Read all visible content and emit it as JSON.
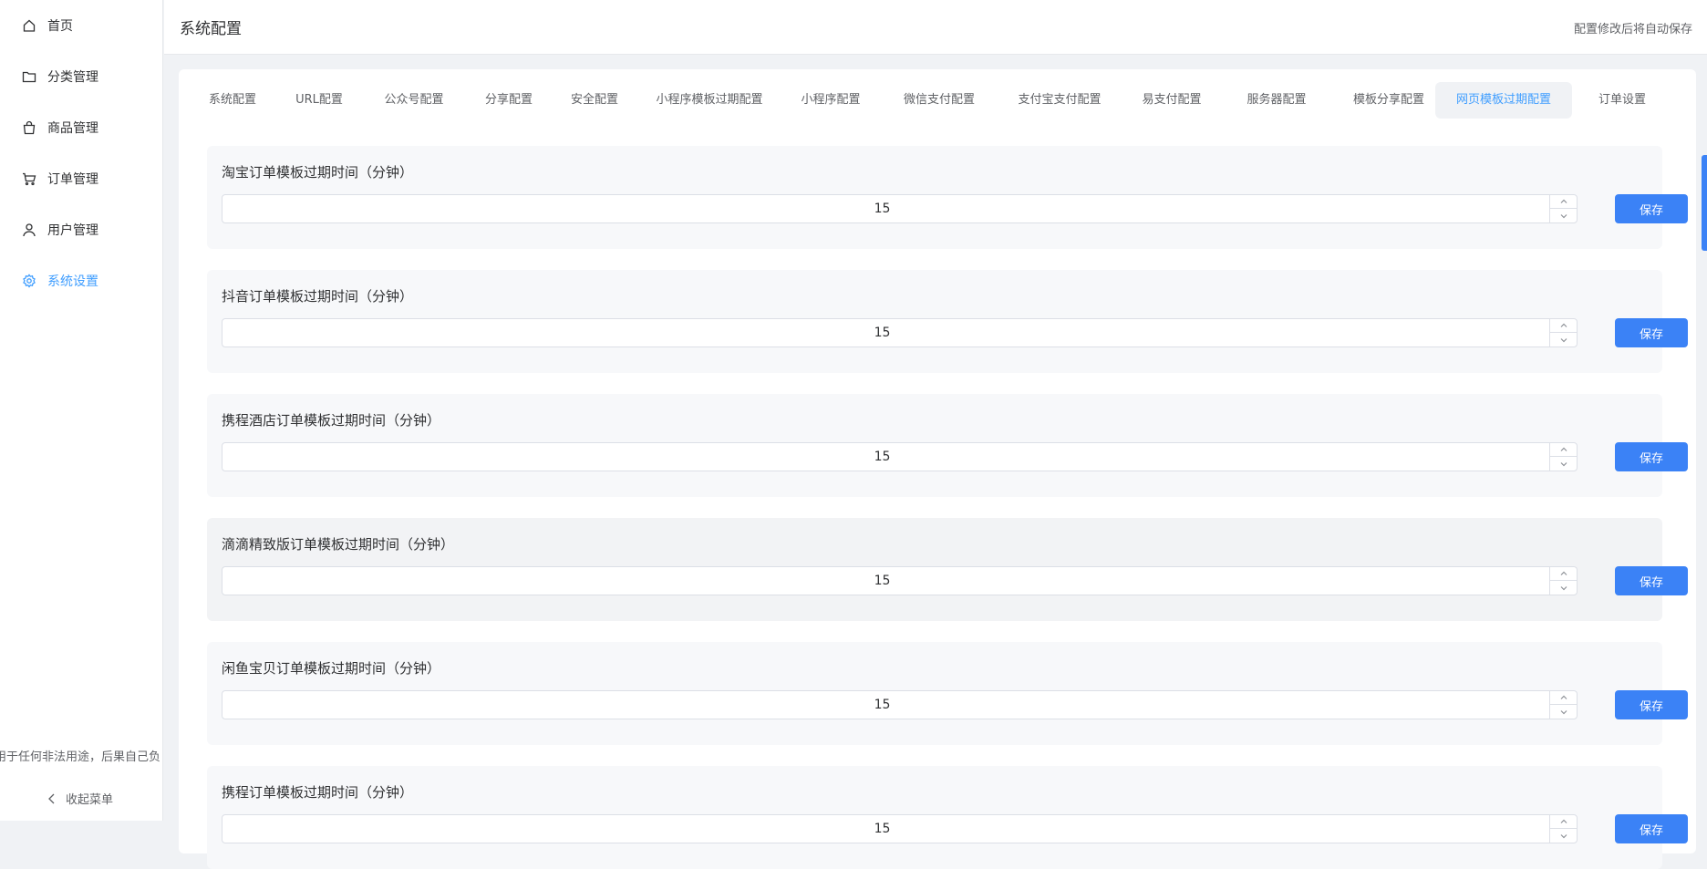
{
  "sidebar": {
    "items": [
      {
        "label": "首页",
        "icon": "home-icon"
      },
      {
        "label": "分类管理",
        "icon": "folder-icon"
      },
      {
        "label": "商品管理",
        "icon": "shopping-bag-icon"
      },
      {
        "label": "订单管理",
        "icon": "cart-icon"
      },
      {
        "label": "用户管理",
        "icon": "user-icon"
      },
      {
        "label": "系统设置",
        "icon": "gear-icon",
        "active": true
      }
    ],
    "disclaimer": "用于任何非法用途，后果自己负",
    "collapse_label": "收起菜单"
  },
  "header": {
    "title": "系统配置",
    "note": "配置修改后将自动保存"
  },
  "tabs": [
    "系统配置",
    "URL配置",
    "公众号配置",
    "分享配置",
    "安全配置",
    "小程序模板过期配置",
    "小程序配置",
    "微信支付配置",
    "支付宝支付配置",
    "易支付配置",
    "服务器配置",
    "模板分享配置",
    "网页模板过期配置",
    "订单设置"
  ],
  "active_tab": "网页模板过期配置",
  "fields": [
    {
      "label": "淘宝订单模板过期时间（分钟）",
      "value": "15"
    },
    {
      "label": "抖音订单模板过期时间（分钟）",
      "value": "15"
    },
    {
      "label": "携程酒店订单模板过期时间（分钟）",
      "value": "15"
    },
    {
      "label": "滴滴精致版订单模板过期时间（分钟）",
      "value": "15"
    },
    {
      "label": "闲鱼宝贝订单模板过期时间（分钟）",
      "value": "15"
    },
    {
      "label": "携程订单模板过期时间（分钟）",
      "value": "15"
    }
  ],
  "save_label": "保存",
  "colors": {
    "accent": "#409eff",
    "button": "#3b82f6",
    "page_bg": "#f0f2f5"
  }
}
